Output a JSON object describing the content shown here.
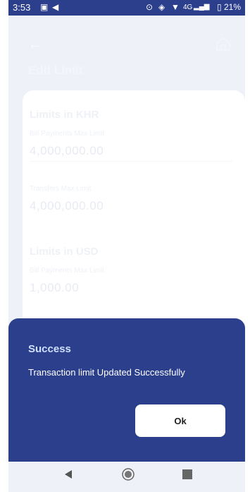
{
  "status_bar": {
    "time": "3:53",
    "network": "4G",
    "battery": "21%"
  },
  "header": {
    "title": "Edit Limit"
  },
  "khr": {
    "section_title": "Limits in KHR",
    "bill_label": "Bill Payments Max Limit",
    "bill_value": "4,000,000.00",
    "transfer_label": "Transfers Max Limit",
    "transfer_value": "4,000,000.00"
  },
  "usd": {
    "section_title": "Limits in USD",
    "bill_label": "Bill Payments Max Limit",
    "bill_value": "1,000.00"
  },
  "dialog": {
    "title": "Success",
    "message": "Transaction limit Updated Successfully",
    "ok_label": "Ok"
  },
  "colors": {
    "primary": "#2c3f8d",
    "background": "#eef2f8"
  },
  "icons": [
    "back-arrow-icon",
    "home-icon",
    "nav-back-icon",
    "nav-home-icon",
    "nav-recents-icon"
  ]
}
